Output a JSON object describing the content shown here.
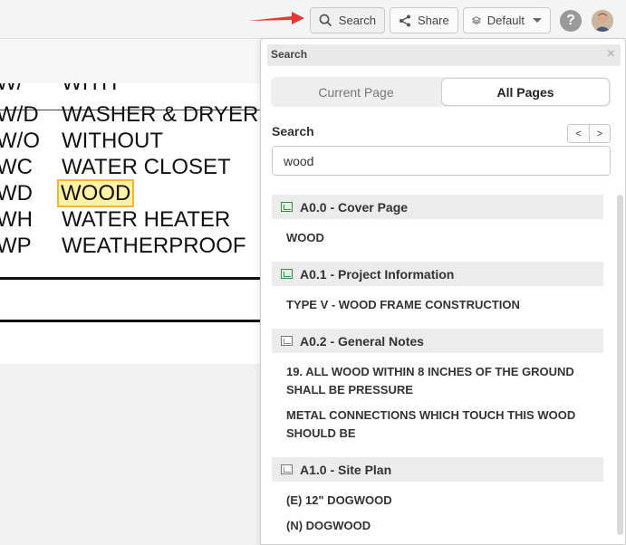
{
  "toolbar": {
    "search_label": "Search",
    "share_label": "Share",
    "default_label": "Default",
    "help_label": "?"
  },
  "drawing": {
    "rows": [
      {
        "abbr": "W/",
        "term": "WITH"
      },
      {
        "abbr": "W/D",
        "term": "WASHER & DRYER"
      },
      {
        "abbr": "W/O",
        "term": "WITHOUT"
      },
      {
        "abbr": "WC",
        "term": "WATER CLOSET"
      },
      {
        "abbr": "WD",
        "term": "WOOD"
      },
      {
        "abbr": "WH",
        "term": "WATER HEATER"
      },
      {
        "abbr": "WP",
        "term": "WEATHERPROOF"
      }
    ],
    "highlight_color": "#fdf2a5"
  },
  "search_panel": {
    "title": "Search",
    "close": "×",
    "tabs": {
      "current": "Current Page",
      "all": "All Pages",
      "active": "All Pages"
    },
    "search_label": "Search",
    "prev": "<",
    "next": ">",
    "query": "wood",
    "results": [
      {
        "sheet": "A0.0 - Cover Page",
        "icon": "sheet-icon-green",
        "matches": [
          "WOOD"
        ]
      },
      {
        "sheet": "A0.1 - Project Information",
        "icon": "sheet-icon-green",
        "matches": [
          "TYPE V - WOOD FRAME CONSTRUCTION"
        ]
      },
      {
        "sheet": "A0.2 - General Notes",
        "icon": "sheet-icon-grey",
        "matches": [
          "19. ALL WOOD WITHIN 8 INCHES OF THE GROUND SHALL BE PRESSURE",
          "METAL CONNECTIONS WHICH TOUCH THIS WOOD SHOULD BE"
        ]
      },
      {
        "sheet": "A1.0 - Site Plan",
        "icon": "sheet-icon-grey",
        "matches": [
          "(E) 12\" DOGWOOD",
          "(N) DOGWOOD"
        ]
      }
    ]
  },
  "colors": {
    "arrow": "#e53935",
    "accent_green": "#3a8a47"
  }
}
